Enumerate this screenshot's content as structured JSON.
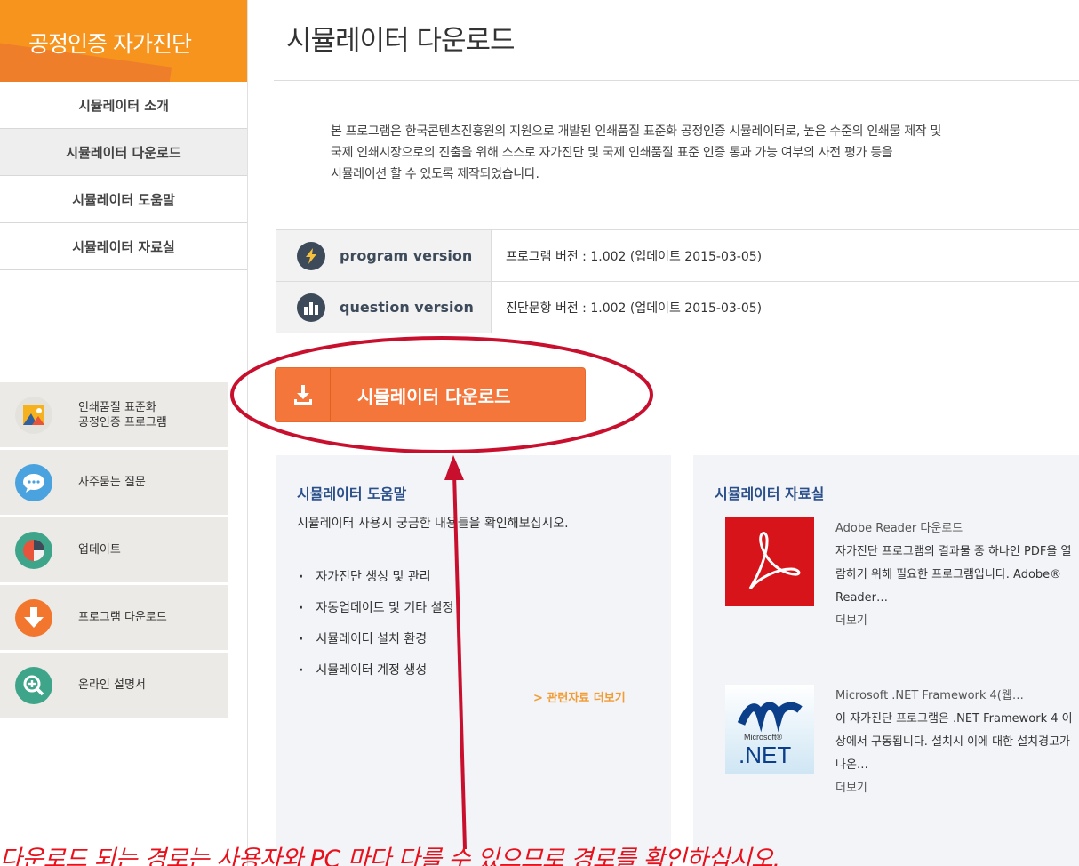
{
  "sidebar": {
    "title": "공정인증 자가진단",
    "nav": [
      {
        "label": "시뮬레이터 소개"
      },
      {
        "label": "시뮬레이터 다운로드"
      },
      {
        "label": "시뮬레이터 도움말"
      },
      {
        "label": "시뮬레이터 자료실"
      }
    ],
    "quick_links": [
      {
        "label": "인쇄품질 표준화\n공정인증 프로그램",
        "icon": "landscape-image-icon"
      },
      {
        "label": "자주묻는 질문",
        "icon": "speech-bubble-icon"
      },
      {
        "label": "업데이트",
        "icon": "pie-chart-icon"
      },
      {
        "label": "프로그램 다운로드",
        "icon": "arrow-down-icon"
      },
      {
        "label": "온라인 설명서",
        "icon": "magnifier-plus-icon"
      }
    ]
  },
  "main": {
    "title": "시뮬레이터 다운로드",
    "intro": "본 프로그램은 한국콘텐츠진흥원의 지원으로 개발된 인쇄품질 표준화 공정인증 시뮬레이터로, 높은 수준의 인쇄물 제작 및\n국제 인쇄시장으로의 진출을 위해 스스로 자가진단 및 국제 인쇄품질 표준 인증 통과 가능 여부의 사전 평가 등을\n시뮬레이션 할 수 있도록 제작되었습니다.",
    "versions": [
      {
        "label": "program version",
        "value": "프로그램 버전 : 1.002 (업데이트 2015-03-05)",
        "icon": "lightning-icon"
      },
      {
        "label": "question version",
        "value": "진단문항 버전 : 1.002 (업데이트 2015-03-05)",
        "icon": "bar-chart-icon"
      }
    ],
    "download_label": "시뮬레이터 다운로드",
    "help": {
      "title": "시뮬레이터 도움말",
      "subtitle": "시뮬레이터 사용시 궁금한 내용들을 확인해보십시오.",
      "items": [
        "자가진단 생성 및 관리",
        "자동업데이트 및 기타 설정",
        "시뮬레이터 설치 환경",
        "시뮬레이터 계정 생성"
      ],
      "more": "> 관련자료 더보기"
    },
    "resources": {
      "title": "시뮬레이터 자료실",
      "items": [
        {
          "title": "Adobe Reader 다운로드",
          "desc": "자가진단 프로그램의 결과물 중 하나인 PDF을 열람하기 위해 필요한 프로그램입니다. Adobe® Reader…",
          "more": "더보기",
          "icon": "adobe-reader-logo"
        },
        {
          "title": "Microsoft .NET Framework 4(웹…",
          "desc": "이 자가진단 프로그램은 .NET Framework 4 이상에서 구동됩니다. 설치시 이에 대한 설치경고가 나온…",
          "more": "더보기",
          "icon": "dotnet-logo",
          "logo_text": "Microsoft®",
          "logo_text2": ".NET"
        }
      ]
    }
  },
  "annotation": {
    "caption": "다운로드 되는 경로는 사용자와 PC 마다 다를 수 있으므로 경로를 확인하십시오.",
    "color": "#c8102e"
  }
}
